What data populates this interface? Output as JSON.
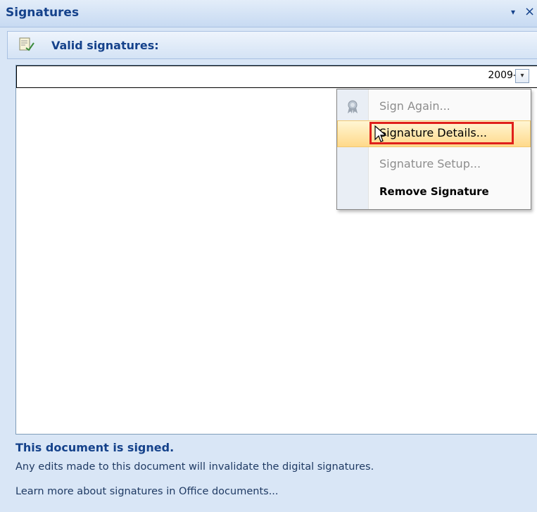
{
  "pane": {
    "title": "Signatures",
    "dropdown_glyph": "▾",
    "close_glyph": "×"
  },
  "section": {
    "title": "Valid signatures:",
    "icon": "signature-list-icon"
  },
  "signatures": [
    {
      "date": "2009-"
    }
  ],
  "row_dropdown_glyph": "▾",
  "context_menu": {
    "items": [
      {
        "label": "Sign Again...",
        "state": "disabled",
        "icon": "seal-icon"
      },
      {
        "label": "Signature Details...",
        "state": "hovered"
      },
      {
        "label": "Signature Setup...",
        "state": "disabled"
      },
      {
        "label": "Remove Signature",
        "state": "enabled"
      }
    ]
  },
  "footer": {
    "status": "This document is signed.",
    "note": "Any edits made to this document will invalidate the digital signatures.",
    "link": "Learn more about signatures in Office documents..."
  },
  "colors": {
    "accent": "#15428b",
    "highlight_border": "#e0201b",
    "hover_fill": "#ffd98a"
  }
}
